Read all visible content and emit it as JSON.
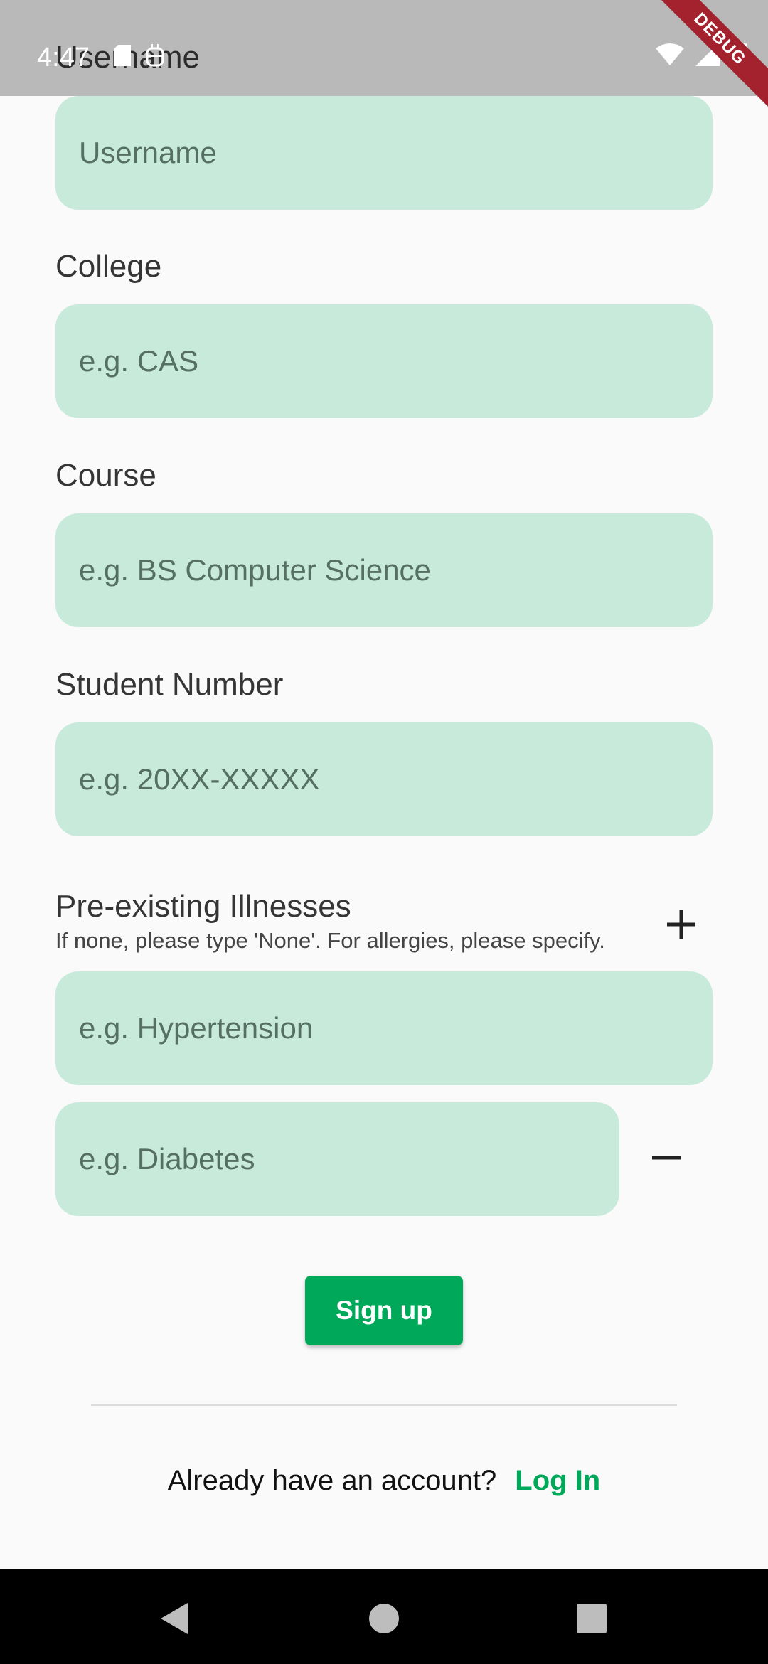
{
  "status": {
    "time": "4:47"
  },
  "debug_label": "DEBUG",
  "form": {
    "username": {
      "label": "Username",
      "placeholder": "Username"
    },
    "college": {
      "label": "College",
      "placeholder": "e.g. CAS"
    },
    "course": {
      "label": "Course",
      "placeholder": "e.g. BS Computer Science"
    },
    "student_number": {
      "label": "Student Number",
      "placeholder": "e.g. 20XX-XXXXX"
    },
    "illnesses": {
      "label": "Pre-existing Illnesses",
      "hint": "If none, please type 'None'. For allergies, please specify.",
      "fields": [
        {
          "placeholder": "e.g. Hypertension"
        },
        {
          "placeholder": "e.g. Diabetes"
        }
      ]
    }
  },
  "signup_label": "Sign up",
  "footer": {
    "prompt": "Already have an account?",
    "login_label": "Log In"
  },
  "colors": {
    "accent": "#00a859",
    "field_bg": "#c8eadb",
    "debug": "#a3222e"
  },
  "icons": {
    "add": "plus-icon",
    "remove": "minus-icon"
  }
}
